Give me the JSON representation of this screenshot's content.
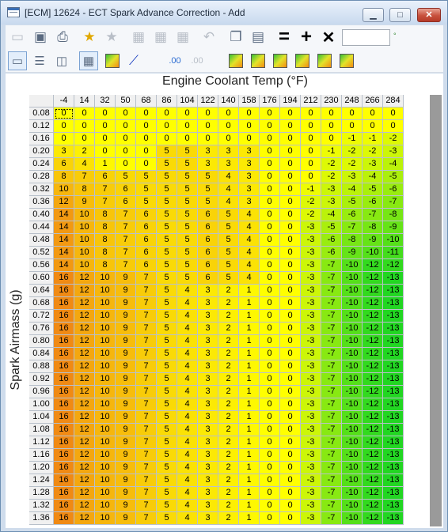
{
  "window": {
    "title": "[ECM] 12624 - ECT Spark Advance Correction - Add",
    "controls": {
      "minimize": "▁",
      "maximize": "□",
      "close": "✕"
    }
  },
  "toolbar": {
    "row1": [
      "open-folder-icon",
      "save-icon",
      "print-icon",
      "add-favorite-icon",
      "remove-favorite-icon",
      "table-icon",
      "table-icon",
      "table-icon",
      "undo-icon",
      "copy-icon",
      "paste-icon",
      "equals-icon",
      "plus-icon",
      "multiply-icon"
    ],
    "operators": {
      "equals": "=",
      "plus": "+",
      "multiply": "✕"
    },
    "zoom_value": "",
    "degree_suffix": "°"
  },
  "table": {
    "x_axis_title": "Engine Coolant Temp (°F)",
    "y_axis_title": "Spark Airmass (g)",
    "columns": [
      "-4",
      "14",
      "32",
      "50",
      "68",
      "86",
      "104",
      "122",
      "140",
      "158",
      "176",
      "194",
      "212",
      "230",
      "248",
      "266",
      "284"
    ],
    "rows": [
      "0.08",
      "0.12",
      "0.16",
      "0.20",
      "0.24",
      "0.28",
      "0.32",
      "0.36",
      "0.40",
      "0.44",
      "0.48",
      "0.52",
      "0.56",
      "0.60",
      "0.64",
      "0.68",
      "0.72",
      "0.76",
      "0.80",
      "0.84",
      "0.88",
      "0.92",
      "0.96",
      "1.00",
      "1.04",
      "1.08",
      "1.12",
      "1.16",
      "1.20",
      "1.24",
      "1.28",
      "1.32",
      "1.36"
    ],
    "values": [
      [
        0,
        0,
        0,
        0,
        0,
        0,
        0,
        0,
        0,
        0,
        0,
        0,
        0,
        0,
        0,
        0,
        0
      ],
      [
        0,
        0,
        0,
        0,
        0,
        0,
        0,
        0,
        0,
        0,
        0,
        0,
        0,
        0,
        0,
        0,
        0
      ],
      [
        0,
        0,
        0,
        0,
        0,
        0,
        0,
        0,
        0,
        0,
        0,
        0,
        0,
        0,
        -1,
        -1,
        -2
      ],
      [
        3,
        2,
        0,
        0,
        0,
        5,
        5,
        3,
        3,
        3,
        0,
        0,
        0,
        -1,
        -2,
        -2,
        -3
      ],
      [
        6,
        4,
        1,
        0,
        0,
        5,
        5,
        3,
        3,
        3,
        0,
        0,
        0,
        -2,
        -2,
        -3,
        -4
      ],
      [
        8,
        7,
        6,
        5,
        5,
        5,
        5,
        5,
        4,
        3,
        0,
        0,
        0,
        -2,
        -3,
        -4,
        -5
      ],
      [
        10,
        8,
        7,
        6,
        5,
        5,
        5,
        5,
        4,
        3,
        0,
        0,
        -1,
        -3,
        -4,
        -5,
        -6
      ],
      [
        12,
        9,
        7,
        6,
        5,
        5,
        5,
        5,
        4,
        3,
        0,
        0,
        -2,
        -3,
        -5,
        -6,
        -7
      ],
      [
        14,
        10,
        8,
        7,
        6,
        5,
        5,
        6,
        5,
        4,
        0,
        0,
        -2,
        -4,
        -6,
        -7,
        -8
      ],
      [
        14,
        10,
        8,
        7,
        6,
        5,
        5,
        6,
        5,
        4,
        0,
        0,
        -3,
        -5,
        -7,
        -8,
        -9
      ],
      [
        14,
        10,
        8,
        7,
        6,
        5,
        5,
        6,
        5,
        4,
        0,
        0,
        -3,
        -6,
        -8,
        -9,
        -10
      ],
      [
        14,
        10,
        8,
        7,
        6,
        5,
        5,
        6,
        5,
        4,
        0,
        0,
        -3,
        -6,
        -9,
        -10,
        -11
      ],
      [
        14,
        10,
        8,
        7,
        6,
        5,
        5,
        6,
        5,
        4,
        0,
        0,
        -3,
        -7,
        -10,
        -12,
        -12
      ],
      [
        16,
        12,
        10,
        9,
        7,
        5,
        5,
        6,
        5,
        4,
        0,
        0,
        -3,
        -7,
        -10,
        -12,
        -13
      ],
      [
        16,
        12,
        10,
        9,
        7,
        5,
        4,
        3,
        2,
        1,
        0,
        0,
        -3,
        -7,
        -10,
        -12,
        -13
      ],
      [
        16,
        12,
        10,
        9,
        7,
        5,
        4,
        3,
        2,
        1,
        0,
        0,
        -3,
        -7,
        -10,
        -12,
        -13
      ],
      [
        16,
        12,
        10,
        9,
        7,
        5,
        4,
        3,
        2,
        1,
        0,
        0,
        -3,
        -7,
        -10,
        -12,
        -13
      ],
      [
        16,
        12,
        10,
        9,
        7,
        5,
        4,
        3,
        2,
        1,
        0,
        0,
        -3,
        -7,
        -10,
        -12,
        -13
      ],
      [
        16,
        12,
        10,
        9,
        7,
        5,
        4,
        3,
        2,
        1,
        0,
        0,
        -3,
        -7,
        -10,
        -12,
        -13
      ],
      [
        16,
        12,
        10,
        9,
        7,
        5,
        4,
        3,
        2,
        1,
        0,
        0,
        -3,
        -7,
        -10,
        -12,
        -13
      ],
      [
        16,
        12,
        10,
        9,
        7,
        5,
        4,
        3,
        2,
        1,
        0,
        0,
        -3,
        -7,
        -10,
        -12,
        -13
      ],
      [
        16,
        12,
        10,
        9,
        7,
        5,
        4,
        3,
        2,
        1,
        0,
        0,
        -3,
        -7,
        -10,
        -12,
        -13
      ],
      [
        16,
        12,
        10,
        9,
        7,
        5,
        4,
        3,
        2,
        1,
        0,
        0,
        -3,
        -7,
        -10,
        -12,
        -13
      ],
      [
        16,
        12,
        10,
        9,
        7,
        5,
        4,
        3,
        2,
        1,
        0,
        0,
        -3,
        -7,
        -10,
        -12,
        -13
      ],
      [
        16,
        12,
        10,
        9,
        7,
        5,
        4,
        3,
        2,
        1,
        0,
        0,
        -3,
        -7,
        -10,
        -12,
        -13
      ],
      [
        16,
        12,
        10,
        9,
        7,
        5,
        4,
        3,
        2,
        1,
        0,
        0,
        -3,
        -7,
        -10,
        -12,
        -13
      ],
      [
        16,
        12,
        10,
        9,
        7,
        5,
        4,
        3,
        2,
        1,
        0,
        0,
        -3,
        -7,
        -10,
        -12,
        -13
      ],
      [
        16,
        12,
        10,
        9,
        7,
        5,
        4,
        3,
        2,
        1,
        0,
        0,
        -3,
        -7,
        -10,
        -12,
        -13
      ],
      [
        16,
        12,
        10,
        9,
        7,
        5,
        4,
        3,
        2,
        1,
        0,
        0,
        -3,
        -7,
        -10,
        -12,
        -13
      ],
      [
        16,
        12,
        10,
        9,
        7,
        5,
        4,
        3,
        2,
        1,
        0,
        0,
        -3,
        -7,
        -10,
        -12,
        -13
      ],
      [
        16,
        12,
        10,
        9,
        7,
        5,
        4,
        3,
        2,
        1,
        0,
        0,
        -3,
        -7,
        -10,
        -12,
        -13
      ],
      [
        16,
        12,
        10,
        9,
        7,
        5,
        4,
        3,
        2,
        1,
        0,
        0,
        -3,
        -7,
        -10,
        -12,
        -13
      ],
      [
        16,
        12,
        10,
        9,
        7,
        5,
        4,
        3,
        2,
        1,
        0,
        0,
        -3,
        -7,
        -10,
        -12,
        -13
      ]
    ],
    "color_scale": {
      "positive_max": "#f08a14",
      "zero": "#ffff00",
      "negative_max": "#22d622"
    },
    "selected_cell": "0.08 / -4"
  }
}
